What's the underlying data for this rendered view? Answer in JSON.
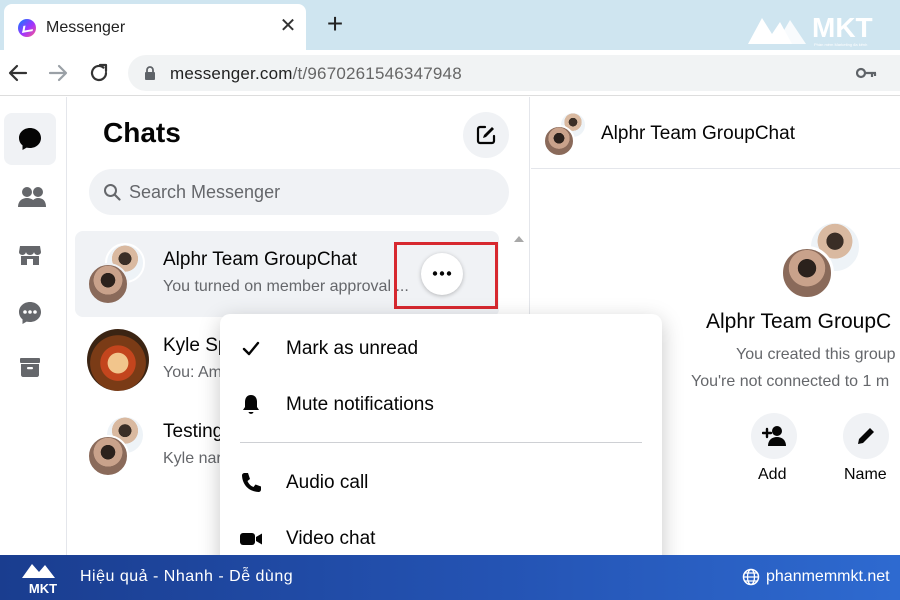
{
  "browser": {
    "tab_title": "Messenger",
    "tab_close": "✕",
    "new_tab": "+",
    "url_main": "messenger.com",
    "url_path": "/t/9670261546347948"
  },
  "watermark": {
    "brand": "MKT",
    "tagline": "Phần mềm Marketing đa kênh"
  },
  "rail": {
    "items": [
      "chats-icon",
      "people-icon",
      "marketplace-icon",
      "message-requests-icon",
      "archive-icon"
    ],
    "active": "chats-icon"
  },
  "chats": {
    "title": "Chats",
    "search_placeholder": "Search Messenger",
    "conversations": [
      {
        "name": "Alphr Team GroupChat",
        "preview": "You turned on member approval ..."
      },
      {
        "name": "Kyle Sp",
        "preview": "You: Am"
      },
      {
        "name": "Testing",
        "preview": "Kyle nar"
      }
    ]
  },
  "context_menu": {
    "items": [
      {
        "label": "Mark as unread",
        "icon": "check-icon"
      },
      {
        "label": "Mute notifications",
        "icon": "bell-icon"
      },
      {
        "label": "Audio call",
        "icon": "phone-icon"
      },
      {
        "label": "Video chat",
        "icon": "video-icon"
      }
    ]
  },
  "conversation": {
    "header_name": "Alphr Team GroupChat",
    "info_name": "Alphr Team GroupC",
    "info_line1": "You created this group",
    "info_line2": "You're not connected to 1 m",
    "actions": [
      {
        "label": "Add",
        "icon": "add-person-icon"
      },
      {
        "label": "Name",
        "icon": "pencil-icon"
      }
    ]
  },
  "banner": {
    "slogan": "Hiệu quả - Nhanh  - Dễ dùng",
    "site": "phanmemmkt.net",
    "logo_text": "MKT"
  },
  "colors": {
    "highlight": "#d7282f",
    "banner": "#2453b3",
    "tabbar": "#cfe5f0"
  }
}
